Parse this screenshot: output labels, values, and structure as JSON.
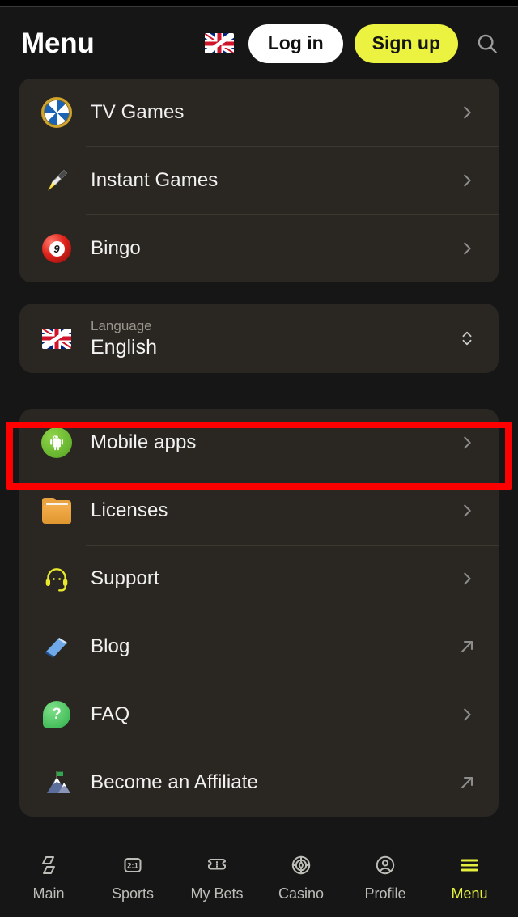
{
  "header": {
    "title": "Menu",
    "flag_icon": "uk-flag-icon",
    "login_label": "Log in",
    "signup_label": "Sign up",
    "search_icon": "search-icon",
    "signup_color": "#ebf23f"
  },
  "games_card": {
    "items": [
      {
        "label": "TV Games",
        "icon": "wheel-of-fortune-icon",
        "arrow": "chevron-right-icon"
      },
      {
        "label": "Instant Games",
        "icon": "rocket-icon",
        "arrow": "chevron-right-icon"
      },
      {
        "label": "Bingo",
        "icon": "billiard-ball-9-icon",
        "arrow": "chevron-right-icon"
      }
    ]
  },
  "language": {
    "caption": "Language",
    "value": "English",
    "flag_icon": "uk-flag-icon",
    "stepper_icon": "chevron-up-down-icon"
  },
  "info_card": {
    "items": [
      {
        "label": "Mobile apps",
        "icon": "android-robot-icon",
        "arrow": "chevron-right-icon",
        "highlighted": true
      },
      {
        "label": "Licenses",
        "icon": "folder-icon",
        "arrow": "chevron-right-icon"
      },
      {
        "label": "Support",
        "icon": "headset-icon",
        "arrow": "chevron-right-icon"
      },
      {
        "label": "Blog",
        "icon": "book-icon",
        "arrow": "external-link-icon"
      },
      {
        "label": "FAQ",
        "icon": "question-bubble-icon",
        "arrow": "chevron-right-icon"
      },
      {
        "label": "Become an Affiliate",
        "icon": "mountain-flag-icon",
        "arrow": "external-link-icon"
      }
    ]
  },
  "highlight": {
    "color": "#ff0000",
    "target": "Mobile apps"
  },
  "bottom_nav": {
    "active": "Menu",
    "active_color": "#e4f03c",
    "items": [
      {
        "label": "Main",
        "icon": "main-tiles-icon"
      },
      {
        "label": "Sports",
        "icon": "odds-2-1-icon",
        "badge": "2:1"
      },
      {
        "label": "My Bets",
        "icon": "ticket-icon"
      },
      {
        "label": "Casino",
        "icon": "casino-chip-icon"
      },
      {
        "label": "Profile",
        "icon": "person-circle-icon"
      },
      {
        "label": "Menu",
        "icon": "hamburger-icon"
      }
    ]
  }
}
